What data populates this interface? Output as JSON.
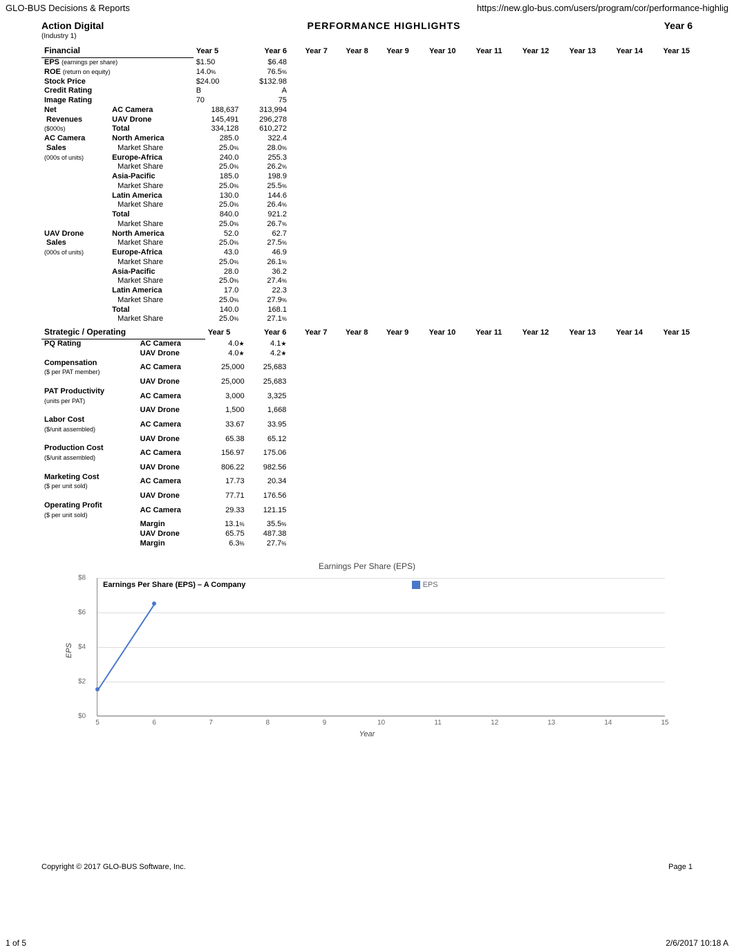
{
  "browser_header": {
    "left": "GLO-BUS Decisions & Reports",
    "right": "https://new.glo-bus.com/users/program/cor/performance-highlig"
  },
  "title_row": {
    "company": "Action Digital",
    "center": "PERFORMANCE  HIGHLIGHTS",
    "year": "Year 6"
  },
  "industry": "(Industry 1)",
  "year_cols": [
    "Year 5",
    "Year 6",
    "Year 7",
    "Year 8",
    "Year 9",
    "Year 10",
    "Year 11",
    "Year 12",
    "Year 13",
    "Year 14",
    "Year 15"
  ],
  "financial_header": "Financial",
  "financial_rows": [
    {
      "l1": "EPS",
      "l1s": "(earnings per share)",
      "l2": "",
      "y5": "$1.50",
      "y6": "$6.48"
    },
    {
      "l1": "ROE",
      "l1s": "(return on equity)",
      "l2": "",
      "y5": "14.0",
      "y6": "76.5",
      "pct": true
    },
    {
      "l1": "Stock Price",
      "l2": "",
      "y5": "$24.00",
      "y6": "$132.98"
    },
    {
      "l1": "Credit Rating",
      "l2": "",
      "y5": "B",
      "y6": "A"
    },
    {
      "l1": "Image Rating",
      "l2": "",
      "y5": "70",
      "y6": "75"
    }
  ],
  "net_rev": {
    "label": "Net Revenues",
    "sub": "($000s)",
    "rows": [
      {
        "l2": "AC Camera",
        "y5": "188,637",
        "y6": "313,994"
      },
      {
        "l2": "UAV Drone",
        "y5": "145,491",
        "y6": "296,278"
      },
      {
        "l2": "Total",
        "y5": "334,128",
        "y6": "610,272"
      }
    ]
  },
  "ac_camera": {
    "label": "AC Camera Sales",
    "sub": "(000s of units)",
    "rows": [
      {
        "l2": "North America",
        "bold": true,
        "y5": "285.0",
        "y6": "322.4"
      },
      {
        "l2": "Market Share",
        "y5": "25.0",
        "y6": "28.0",
        "pct": true,
        "indent": true
      },
      {
        "l2": "Europe-Africa",
        "bold": true,
        "y5": "240.0",
        "y6": "255.3"
      },
      {
        "l2": "Market Share",
        "y5": "25.0",
        "y6": "26.2",
        "pct": true,
        "indent": true
      },
      {
        "l2": "Asia-Pacific",
        "bold": true,
        "y5": "185.0",
        "y6": "198.9"
      },
      {
        "l2": "Market Share",
        "y5": "25.0",
        "y6": "25.5",
        "pct": true,
        "indent": true
      },
      {
        "l2": "Latin America",
        "bold": true,
        "y5": "130.0",
        "y6": "144.6"
      },
      {
        "l2": "Market Share",
        "y5": "25.0",
        "y6": "26.4",
        "pct": true,
        "indent": true
      },
      {
        "l2": "Total",
        "bold": true,
        "y5": "840.0",
        "y6": "921.2"
      },
      {
        "l2": "Market Share",
        "y5": "25.0",
        "y6": "26.7",
        "pct": true,
        "indent": true
      }
    ]
  },
  "uav_drone": {
    "label": "UAV Drone Sales",
    "sub": "(000s of units)",
    "rows": [
      {
        "l2": "North America",
        "bold": true,
        "y5": "52.0",
        "y6": "62.7"
      },
      {
        "l2": "Market Share",
        "y5": "25.0",
        "y6": "27.5",
        "pct": true,
        "indent": true
      },
      {
        "l2": "Europe-Africa",
        "bold": true,
        "y5": "43.0",
        "y6": "46.9"
      },
      {
        "l2": "Market Share",
        "y5": "25.0",
        "y6": "26.1",
        "pct": true,
        "indent": true
      },
      {
        "l2": "Asia-Pacific",
        "bold": true,
        "y5": "28.0",
        "y6": "36.2"
      },
      {
        "l2": "Market Share",
        "y5": "25.0",
        "y6": "27.4",
        "pct": true,
        "indent": true
      },
      {
        "l2": "Latin America",
        "bold": true,
        "y5": "17.0",
        "y6": "22.3"
      },
      {
        "l2": "Market Share",
        "y5": "25.0",
        "y6": "27.9",
        "pct": true,
        "indent": true
      },
      {
        "l2": "Total",
        "bold": true,
        "y5": "140.0",
        "y6": "168.1"
      },
      {
        "l2": "Market Share",
        "y5": "25.0",
        "y6": "27.1",
        "pct": true,
        "indent": true
      }
    ]
  },
  "strategic_header": "Strategic / Operating",
  "strategic_rows": [
    {
      "l1": "PQ Rating",
      "l2": "AC Camera",
      "y5": "4.0",
      "y6": "4.1",
      "star": true
    },
    {
      "l1": "",
      "l2": "UAV Drone",
      "y5": "4.0",
      "y6": "4.2",
      "star": true
    },
    {
      "l1": "Compensation",
      "l1s": "($ per PAT member)",
      "l2": "AC Camera",
      "y5": "25,000",
      "y6": "25,683"
    },
    {
      "l1": "",
      "l2": "UAV Drone",
      "y5": "25,000",
      "y6": "25,683"
    },
    {
      "l1": "PAT Productivity",
      "l1s": "(units per PAT)",
      "l2": "AC Camera",
      "y5": "3,000",
      "y6": "3,325"
    },
    {
      "l1": "",
      "l2": "UAV Drone",
      "y5": "1,500",
      "y6": "1,668"
    },
    {
      "l1": "Labor Cost",
      "l1s": "($/unit assembled)",
      "l2": "AC Camera",
      "y5": "33.67",
      "y6": "33.95"
    },
    {
      "l1": "",
      "l2": "UAV Drone",
      "y5": "65.38",
      "y6": "65.12"
    },
    {
      "l1": "Production Cost",
      "l1s": "($/unit assembled)",
      "l2": "AC Camera",
      "y5": "156.97",
      "y6": "175.06"
    },
    {
      "l1": "",
      "l2": "UAV Drone",
      "y5": "806.22",
      "y6": "982.56"
    },
    {
      "l1": "Marketing Cost",
      "l1s": "($ per unit sold)",
      "l2": "AC Camera",
      "y5": "17.73",
      "y6": "20.34"
    },
    {
      "l1": "",
      "l2": "UAV Drone",
      "y5": "77.71",
      "y6": "176.56"
    },
    {
      "l1": "Operating Profit",
      "l1s": "($ per unit sold)",
      "l2": "AC Camera",
      "y5": "29.33",
      "y6": "121.15"
    },
    {
      "l1": "",
      "l2": "Margin",
      "y5": "13.1",
      "y6": "35.5",
      "pct": true
    },
    {
      "l1": "",
      "l2": "UAV Drone",
      "y5": "65.75",
      "y6": "487.38"
    },
    {
      "l1": "",
      "l2": "Margin",
      "y5": "6.3",
      "y6": "27.7",
      "pct": true
    }
  ],
  "chart_section_title": "Earnings Per Share (EPS)",
  "chart_inner_title": "Earnings Per Share (EPS) – A Company",
  "chart_legend": "EPS",
  "chart_ylabel": "EPS",
  "chart_xlabel": "Year",
  "chart_yticks": [
    "$0",
    "$2",
    "$4",
    "$6",
    "$8"
  ],
  "chart_xticks": [
    "5",
    "6",
    "7",
    "8",
    "9",
    "10",
    "11",
    "12",
    "13",
    "14",
    "15"
  ],
  "chart_data": {
    "type": "line",
    "title": "Earnings Per Share (EPS) – A Company",
    "xlabel": "Year",
    "ylabel": "EPS",
    "x": [
      5,
      6
    ],
    "series": [
      {
        "name": "EPS",
        "values": [
          1.5,
          6.48
        ]
      }
    ],
    "ylim": [
      0,
      8
    ],
    "xlim": [
      5,
      15
    ]
  },
  "footer": {
    "copyright": "Copyright © 2017 GLO-BUS Software, Inc.",
    "page": "Page 1"
  },
  "page_count": "1 of 5",
  "page_date": "2/6/2017 10:18 A"
}
